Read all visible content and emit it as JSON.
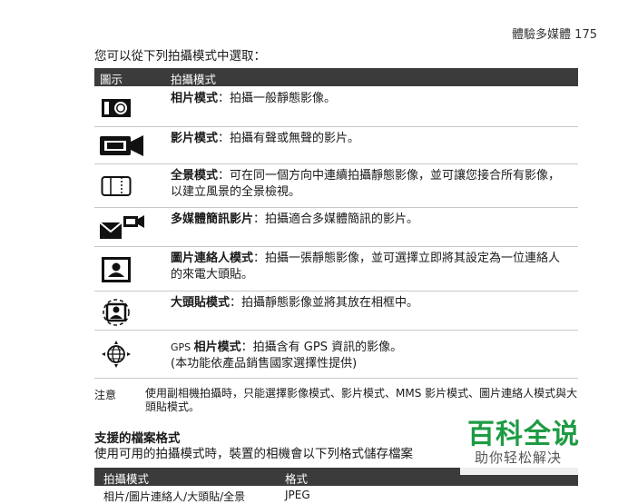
{
  "header": {
    "text": "體驗多媒體 175"
  },
  "intro": "您可以從下列拍攝模式中選取：",
  "table": {
    "headers": [
      "圖示",
      "拍攝模式"
    ],
    "rows": [
      {
        "icon": "camera-photo-icon",
        "title": "相片模式",
        "text": "：拍攝一般靜態影像。"
      },
      {
        "icon": "video-camera-icon",
        "title": "影片模式",
        "text": "：拍攝有聲或無聲的影片。"
      },
      {
        "icon": "panorama-icon",
        "title": "全景模式",
        "text": "：可在同一個方向中連續拍攝靜態影像，並可讓您接合所有影像，以建立風景的全景檢視。"
      },
      {
        "icon": "mms-video-icon",
        "title": "多媒體簡訊影片",
        "text": "：拍攝適合多媒體簡訊的影片。"
      },
      {
        "icon": "contact-picture-icon",
        "title": "圖片連絡人模式",
        "text": "：拍攝一張靜態影像，並可選擇立即將其設定為一位連絡人的來電大頭貼。"
      },
      {
        "icon": "picture-theme-icon",
        "title": "大頭貼模式",
        "text": "：拍攝靜態影像並將其放在相框中。"
      },
      {
        "icon": "gps-photo-icon",
        "prefix": "GPS ",
        "title": "相片模式",
        "text": "：拍攝含有 GPS 資訊的影像。",
        "text2": "(本功能依產品銷售國家選擇性提供)"
      }
    ]
  },
  "note": {
    "label": "注意",
    "text": "使用副相機拍攝時，只能選擇影像模式、影片模式、MMS 影片模式、圖片連絡人模式與大頭貼模式。"
  },
  "section": {
    "title": "支援的檔案格式",
    "text": "使用可用的拍攝模式時，裝置的相機會以下列格式儲存檔案"
  },
  "table2": {
    "headers": [
      "拍攝模式",
      "格式"
    ],
    "first_row": [
      "相片/圖片連絡人/大頭貼/全景",
      "JPEG"
    ]
  },
  "watermark": {
    "line1": "百科全说",
    "line2": "助你轻松解决"
  }
}
